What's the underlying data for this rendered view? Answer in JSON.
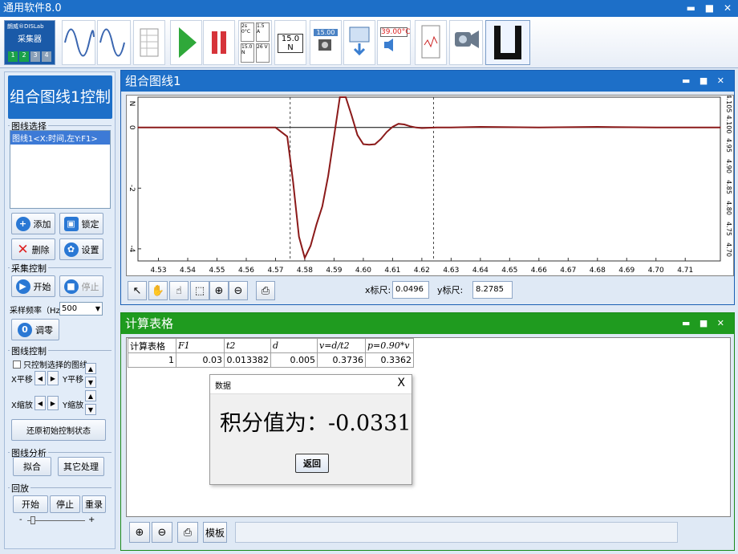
{
  "app": {
    "title": "通用软件8.0",
    "window_controls": "▬ ■ ✕"
  },
  "toolbar": {
    "collector_brand": "朗威®DISLab",
    "collector_label": "采集器",
    "collector_channels": [
      "1",
      "2",
      "3",
      "4"
    ],
    "meter_labels": [
      "2s 0°C",
      "1.5 A",
      "15.0 N",
      "26 V"
    ],
    "big_meter": "15.0 N",
    "temp_readout": "39.00°C",
    "freq_readout": "15.00"
  },
  "left_panel": {
    "title": "组合图线1控制",
    "curve_select": {
      "label": "图线选择",
      "items": [
        "图线1<X:时间,左Y:F1>"
      ]
    },
    "buttons": {
      "add": "添加",
      "lock": "锁定",
      "delete": "删除",
      "settings": "设置"
    },
    "acquisition": {
      "label": "采集控制",
      "start": "开始",
      "stop": "停止",
      "rate_label": "采样频率（Hz）",
      "rate_value": "500",
      "zero_icon": "0",
      "zero": "调零"
    },
    "curve_control": {
      "label": "图线控制",
      "only_selected": "只控制选择的图线",
      "x_move": "X平移",
      "y_move": "Y平移",
      "x_scale": "X缩放",
      "y_scale": "Y缩放",
      "reset": "还原初始控制状态"
    },
    "analysis": {
      "label": "图线分析",
      "fit": "拟合",
      "other": "其它处理"
    },
    "playback": {
      "label": "回放",
      "start": "开始",
      "stop": "停止",
      "replay": "重录",
      "slider_minus": "-",
      "slider_plus": "+"
    }
  },
  "chart_window": {
    "title": "组合图线1",
    "window_controls": "▬ ■ ✕",
    "x_readout_label": "x标尺:",
    "x_readout_value": "0.0496",
    "y_readout_label": "y标尺:",
    "y_readout_value": "8.2785"
  },
  "chart_data": {
    "type": "line",
    "x_ticks": [
      "4.53",
      "4.54",
      "4.55",
      "4.56",
      "4.57",
      "4.58",
      "4.59",
      "4.60",
      "4.61",
      "4.62",
      "4.63",
      "4.64",
      "4.65",
      "4.66",
      "4.67",
      "4.68",
      "4.69",
      "4.70",
      "4.71"
    ],
    "xlim": [
      4.523,
      4.722
    ],
    "y_ticks": [
      "0",
      "-2",
      "-4"
    ],
    "ylim": [
      -4.4,
      1.0
    ],
    "y_axis_letter": "N",
    "right_axis_ticks": [
      "4.70",
      "4.75",
      "4.80",
      "4.85",
      "4.90",
      "4.95",
      "4.100",
      "4.105"
    ],
    "cursor_lines_x": [
      4.575,
      4.624
    ],
    "grid": false,
    "series": [
      {
        "color": "#8b1a1a",
        "x": [
          4.523,
          4.57,
          4.574,
          4.576,
          4.578,
          4.58,
          4.582,
          4.584,
          4.586,
          4.588,
          4.59,
          4.592,
          4.594,
          4.596,
          4.598,
          4.6,
          4.602,
          4.604,
          4.606,
          4.608,
          4.61,
          4.612,
          4.614,
          4.616,
          4.618,
          4.62,
          4.625,
          4.63,
          4.64,
          4.66,
          4.68,
          4.7,
          4.722
        ],
        "y": [
          0,
          0,
          -0.3,
          -1.8,
          -3.6,
          -4.3,
          -3.9,
          -3.2,
          -2.6,
          -1.6,
          -0.3,
          1.0,
          1.0,
          0.4,
          -0.25,
          -0.55,
          -0.57,
          -0.55,
          -0.38,
          -0.15,
          0.02,
          0.12,
          0.1,
          0.04,
          0.0,
          -0.02,
          0.0,
          0.0,
          0.02,
          0.0,
          0.02,
          0.0,
          0.0
        ]
      }
    ]
  },
  "calc_window": {
    "title": "计算表格",
    "window_controls": "▬ ■ ✕",
    "headers": [
      "计算表格",
      "F1",
      "t2",
      "d",
      "v=d/t2",
      "p=0.90*v"
    ],
    "rows": [
      [
        "1",
        "0.03",
        "0.013382",
        "0.005",
        "0.3736",
        "0.3362"
      ]
    ],
    "template_button": "模板"
  },
  "dialog": {
    "title": "数据",
    "close": "X",
    "message": "积分值为：-0.0331",
    "ok": "返回"
  }
}
